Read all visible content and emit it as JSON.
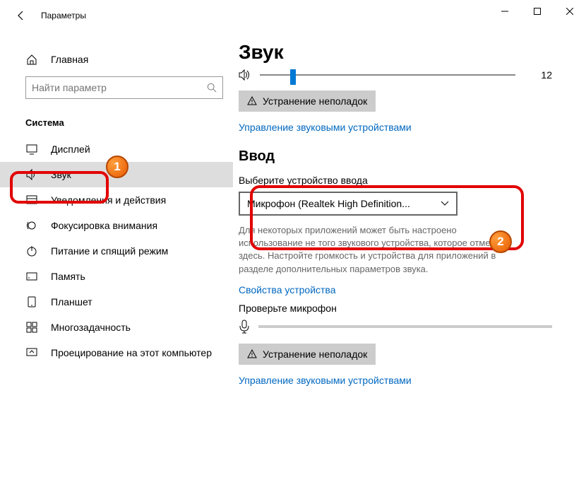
{
  "window": {
    "title": "Параметры"
  },
  "sidebar": {
    "home": "Главная",
    "search_placeholder": "Найти параметр",
    "category": "Система",
    "items": [
      {
        "label": "Дисплей",
        "icon": "display"
      },
      {
        "label": "Звук",
        "icon": "sound",
        "selected": true
      },
      {
        "label": "Уведомления и действия",
        "icon": "notifications"
      },
      {
        "label": "Фокусировка внимания",
        "icon": "focus"
      },
      {
        "label": "Питание и спящий режим",
        "icon": "power"
      },
      {
        "label": "Память",
        "icon": "storage"
      },
      {
        "label": "Планшет",
        "icon": "tablet"
      },
      {
        "label": "Многозадачность",
        "icon": "multitask"
      },
      {
        "label": "Проецирование на этот компьютер",
        "icon": "project"
      }
    ]
  },
  "main": {
    "title": "Звук",
    "volume_value": "12",
    "volume_percent": 12,
    "troubleshoot": "Устранение неполадок",
    "manage_devices": "Управление звуковыми устройствами",
    "input": {
      "heading": "Ввод",
      "select_label": "Выберите устройство ввода",
      "selected_device": "Микрофон (Realtek High Definition...",
      "description": "Для некоторых приложений может быть настроено использование не того звукового устройства, которое отмечено здесь. Настройте громкость и устройства для приложений в разделе дополнительных параметров звука.",
      "properties": "Свойства устройства",
      "test_mic": "Проверьте микрофон",
      "troubleshoot": "Устранение неполадок",
      "manage_devices": "Управление звуковыми устройствами"
    }
  },
  "annotations": {
    "badge1": "1",
    "badge2": "2"
  }
}
